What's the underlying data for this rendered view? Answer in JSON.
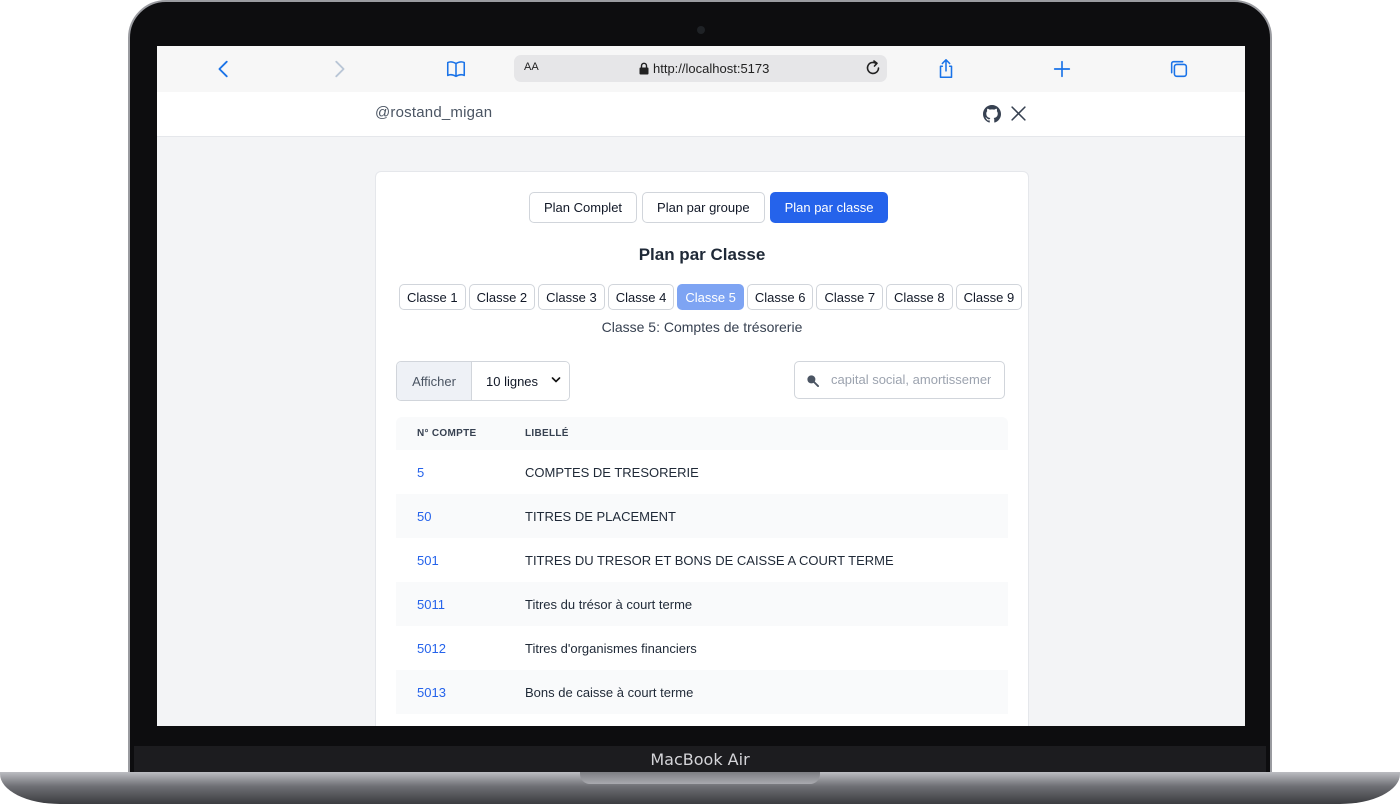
{
  "device": {
    "label": "MacBook Air"
  },
  "browser": {
    "text_size_label": "AA",
    "url": "http://localhost:5173"
  },
  "site": {
    "handle": "@rostand_migan"
  },
  "tabs": [
    {
      "label": "Plan Complet",
      "active": false
    },
    {
      "label": "Plan par groupe",
      "active": false
    },
    {
      "label": "Plan par classe",
      "active": true
    }
  ],
  "page_title": "Plan par Classe",
  "classes": [
    {
      "label": "Classe 1",
      "active": false
    },
    {
      "label": "Classe 2",
      "active": false
    },
    {
      "label": "Classe 3",
      "active": false
    },
    {
      "label": "Classe 4",
      "active": false
    },
    {
      "label": "Classe 5",
      "active": true
    },
    {
      "label": "Classe 6",
      "active": false
    },
    {
      "label": "Classe 7",
      "active": false
    },
    {
      "label": "Classe 8",
      "active": false
    },
    {
      "label": "Classe 9",
      "active": false
    }
  ],
  "class_subtitle": "Classe 5: Comptes de trésorerie",
  "show": {
    "label": "Afficher",
    "selected": "10 lignes"
  },
  "search": {
    "placeholder": "capital social, amortissement"
  },
  "table": {
    "columns": [
      "N° COMPTE",
      "LIBELLÉ"
    ],
    "rows": [
      {
        "num": "5",
        "label": "COMPTES DE TRESORERIE"
      },
      {
        "num": "50",
        "label": "TITRES DE PLACEMENT"
      },
      {
        "num": "501",
        "label": "TITRES DU TRESOR ET BONS DE CAISSE A COURT TERME"
      },
      {
        "num": "5011",
        "label": "Titres du trésor à court terme"
      },
      {
        "num": "5012",
        "label": "Titres d'organismes financiers"
      },
      {
        "num": "5013",
        "label": "Bons de caisse à court terme"
      }
    ]
  },
  "colors": {
    "accent": "#2563eb",
    "accent_light": "#7ea4f3",
    "link": "#2563eb"
  }
}
